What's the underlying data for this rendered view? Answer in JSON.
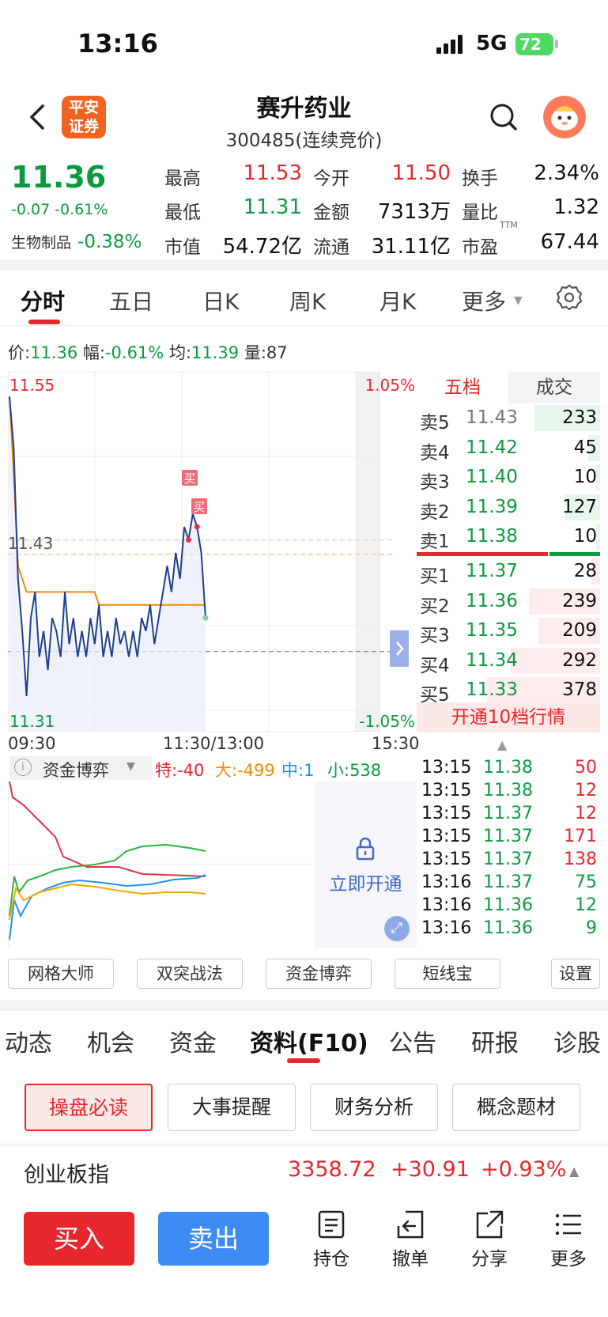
{
  "status": {
    "time": "13:16",
    "network": "5G",
    "battery": "72"
  },
  "header": {
    "logo_line1": "平安",
    "logo_line2": "证券",
    "stock_name": "赛升药业",
    "stock_code": "300485(连续竞价)"
  },
  "quote": {
    "price": "11.36",
    "change": "-0.07 -0.61%",
    "industry_label": "生物制品",
    "industry_change": "-0.38%",
    "fields": [
      {
        "k": "最高",
        "v": "11.53",
        "color": "#e8262d"
      },
      {
        "k": "今开",
        "v": "11.50",
        "color": "#e8262d"
      },
      {
        "k": "换手",
        "v": "2.34%",
        "color": "#111111"
      },
      {
        "k": "最低",
        "v": "11.31",
        "color": "#0b9b3e"
      },
      {
        "k": "金额",
        "v": "7313万",
        "color": "#111111"
      },
      {
        "k": "量比",
        "v": "1.32",
        "color": "#111111"
      },
      {
        "k": "市值",
        "v": "54.72亿",
        "color": "#111111"
      },
      {
        "k": "流通",
        "v": "31.11亿",
        "color": "#111111"
      },
      {
        "k": "市盈",
        "v": "67.44",
        "color": "#111111"
      }
    ],
    "pe_superscript": "TTM"
  },
  "chart_tabs": [
    "分时",
    "五日",
    "日K",
    "周K",
    "月K",
    "更多"
  ],
  "info_line": {
    "price_label": "价:",
    "price": "11.36",
    "amp_label": "幅:",
    "amp": "-0.61%",
    "avg_label": "均:",
    "avg": "11.39",
    "vol_label": "量:",
    "vol": "87"
  },
  "chart_data": {
    "type": "line",
    "title": "",
    "y_high": "11.55",
    "y_low": "11.31",
    "y_mid": "11.43",
    "pct_high": "1.05%",
    "pct_low": "-1.05%",
    "x_labels": [
      "09:30",
      "11:30/13:00",
      "15:30"
    ],
    "ylim": [
      11.31,
      11.55
    ],
    "prev_close": 11.43,
    "series": [
      {
        "values": [
          11.54,
          11.5,
          11.4,
          11.36,
          11.31,
          11.37,
          11.39,
          11.34,
          11.36,
          11.33,
          11.37,
          11.36,
          11.34,
          11.39,
          11.35,
          11.37,
          11.34,
          11.36,
          11.34,
          11.37,
          11.35,
          11.38,
          11.34,
          11.36,
          11.34,
          11.37,
          11.35,
          11.36,
          11.34,
          11.36,
          11.34,
          11.37,
          11.36,
          11.38,
          11.35,
          11.37,
          11.39,
          11.41,
          11.39,
          11.42,
          11.4,
          11.44,
          11.43,
          11.45,
          11.44,
          11.42,
          11.37
        ]
      },
      {
        "values": [
          11.54,
          11.48,
          11.41,
          11.4,
          11.39,
          11.39,
          11.39,
          11.39,
          11.39,
          11.39,
          11.39,
          11.39,
          11.39,
          11.39,
          11.39,
          11.39,
          11.39,
          11.39,
          11.39,
          11.39,
          11.39,
          11.38,
          11.38,
          11.38,
          11.38,
          11.38,
          11.38,
          11.38,
          11.38,
          11.38,
          11.38,
          11.38,
          11.38,
          11.38,
          11.38,
          11.38,
          11.38,
          11.38,
          11.38,
          11.38,
          11.38,
          11.38,
          11.38,
          11.38,
          11.38,
          11.38,
          11.38
        ]
      }
    ],
    "marker_text": "买"
  },
  "order_book": {
    "tabs": [
      "五档",
      "成交"
    ],
    "asks": [
      {
        "label": "卖5",
        "price": "11.43",
        "vol": "233",
        "bar": 0.55
      },
      {
        "label": "卖4",
        "price": "11.42",
        "vol": "45",
        "bar": 0.1
      },
      {
        "label": "卖3",
        "price": "11.40",
        "vol": "10",
        "bar": 0.03
      },
      {
        "label": "卖2",
        "price": "11.39",
        "vol": "127",
        "bar": 0.3
      },
      {
        "label": "卖1",
        "price": "11.38",
        "vol": "10",
        "bar": 0.03
      }
    ],
    "bids": [
      {
        "label": "买1",
        "price": "11.37",
        "vol": "28",
        "bar": 0.07
      },
      {
        "label": "买2",
        "price": "11.36",
        "vol": "239",
        "bar": 0.6
      },
      {
        "label": "买3",
        "price": "11.35",
        "vol": "209",
        "bar": 0.52
      },
      {
        "label": "买4",
        "price": "11.34",
        "vol": "292",
        "bar": 0.75
      },
      {
        "label": "买5",
        "price": "11.33",
        "vol": "378",
        "bar": 0.95
      }
    ],
    "upgrade_label": "开通10档行情",
    "ticks": [
      {
        "t": "13:15",
        "p": "11.38",
        "v": "50",
        "side": "buy"
      },
      {
        "t": "13:15",
        "p": "11.38",
        "v": "12",
        "side": "buy"
      },
      {
        "t": "13:15",
        "p": "11.37",
        "v": "12",
        "side": "buy"
      },
      {
        "t": "13:15",
        "p": "11.37",
        "v": "171",
        "side": "buy"
      },
      {
        "t": "13:15",
        "p": "11.37",
        "v": "138",
        "side": "buy"
      },
      {
        "t": "13:16",
        "p": "11.37",
        "v": "75",
        "side": "sell"
      },
      {
        "t": "13:16",
        "p": "11.36",
        "v": "12",
        "side": "sell"
      },
      {
        "t": "13:16",
        "p": "11.36",
        "v": "9",
        "side": "sell"
      }
    ]
  },
  "indicator": {
    "name": "资金博弈",
    "te": "特:-40",
    "da": "大:-499",
    "zhong": "中:1",
    "xiao": "小:538",
    "unlock_label": "立即开通"
  },
  "tools": [
    "网格大师",
    "双突战法",
    "资金博弈",
    "短线宝",
    "设置"
  ],
  "info_tabs": [
    "动态",
    "机会",
    "资金",
    "资料(F10)",
    "公告",
    "研报",
    "诊股"
  ],
  "sub_buttons": [
    "操盘必读",
    "大事提醒",
    "财务分析",
    "概念题材"
  ],
  "index_bar": {
    "name": "创业板指",
    "value": "3358.72",
    "change": "+30.91",
    "pct": "+0.93%"
  },
  "bottom": {
    "buy": "买入",
    "sell": "卖出",
    "hold": "持仓",
    "cancel": "撤单",
    "share": "分享",
    "more": "更多"
  },
  "colors": {
    "up": "#e8262d",
    "down": "#0b9b3e",
    "accent": "#3d8bf5",
    "avg_line": "#f28c00",
    "price_line": "#1f3f8f"
  }
}
